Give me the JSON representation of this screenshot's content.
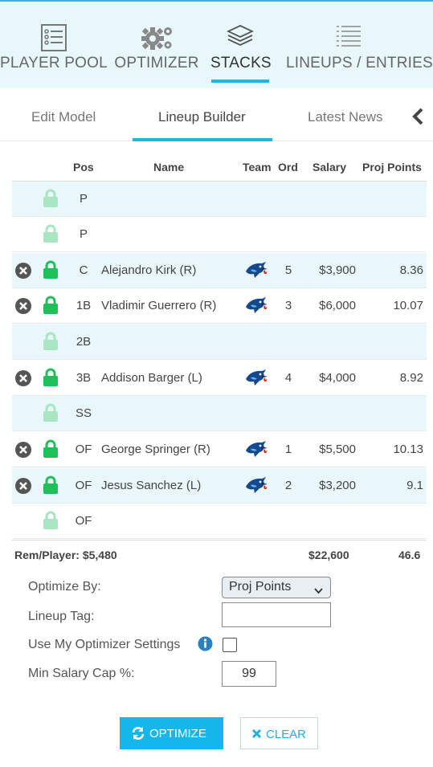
{
  "nav": {
    "items": [
      {
        "label": "PLAYER POOL",
        "icon": "list-icon"
      },
      {
        "label": "OPTIMIZER",
        "icon": "gears-icon"
      },
      {
        "label": "STACKS",
        "icon": "layers-icon",
        "active": true
      },
      {
        "label": "LINEUPS / ENTRIES",
        "icon": "lines-icon"
      }
    ]
  },
  "subtabs": {
    "items": [
      {
        "label": "Edit Model"
      },
      {
        "label": "Lineup Builder",
        "active": true
      },
      {
        "label": "Latest News"
      }
    ],
    "more_icon": "chevron-left-icon"
  },
  "table": {
    "headers": {
      "pos": "Pos",
      "name": "Name",
      "team": "Team",
      "ord": "Ord",
      "salary": "Salary",
      "proj": "Proj Points"
    },
    "rows": [
      {
        "pos": "P",
        "name": "",
        "team": "",
        "ord": "",
        "salary": "",
        "proj": "",
        "filled": false
      },
      {
        "pos": "P",
        "name": "",
        "team": "",
        "ord": "",
        "salary": "",
        "proj": "",
        "filled": false
      },
      {
        "pos": "C",
        "name": "Alejandro Kirk (R)",
        "team": "blue-jays-logo",
        "ord": "5",
        "salary": "$3,900",
        "proj": "8.36",
        "filled": true
      },
      {
        "pos": "1B",
        "name": "Vladimir Guerrero (R)",
        "team": "blue-jays-logo",
        "ord": "3",
        "salary": "$6,000",
        "proj": "10.07",
        "filled": true
      },
      {
        "pos": "2B",
        "name": "",
        "team": "",
        "ord": "",
        "salary": "",
        "proj": "",
        "filled": false
      },
      {
        "pos": "3B",
        "name": "Addison Barger (L)",
        "team": "blue-jays-logo",
        "ord": "4",
        "salary": "$4,000",
        "proj": "8.92",
        "filled": true
      },
      {
        "pos": "SS",
        "name": "",
        "team": "",
        "ord": "",
        "salary": "",
        "proj": "",
        "filled": false
      },
      {
        "pos": "OF",
        "name": "George Springer (R)",
        "team": "blue-jays-logo",
        "ord": "1",
        "salary": "$5,500",
        "proj": "10.13",
        "filled": true
      },
      {
        "pos": "OF",
        "name": "Jesus Sanchez (L)",
        "team": "blue-jays-logo",
        "ord": "2",
        "salary": "$3,200",
        "proj": "9.1",
        "filled": true
      },
      {
        "pos": "OF",
        "name": "",
        "team": "",
        "ord": "",
        "salary": "",
        "proj": "",
        "filled": false
      }
    ],
    "totals": {
      "rem_label": "Rem/Player: $5,480",
      "salary": "$22,600",
      "proj": "46.6"
    }
  },
  "form": {
    "optimize_by_label": "Optimize By:",
    "optimize_by_value": "Proj Points",
    "lineup_tag_label": "Lineup Tag:",
    "lineup_tag_value": "",
    "use_settings_label": "Use My Optimizer Settings",
    "use_settings_checked": false,
    "min_salary_label": "Min Salary Cap %:",
    "min_salary_value": "99"
  },
  "buttons": {
    "optimize_label": "OPTIMIZE",
    "clear_label": "CLEAR"
  },
  "colors": {
    "accent": "#15b7ea",
    "row_alt": "#e9f7fa",
    "lock_filled": "#1fbf5a",
    "lock_empty": "#a8e6c2",
    "remove": "#555555"
  }
}
